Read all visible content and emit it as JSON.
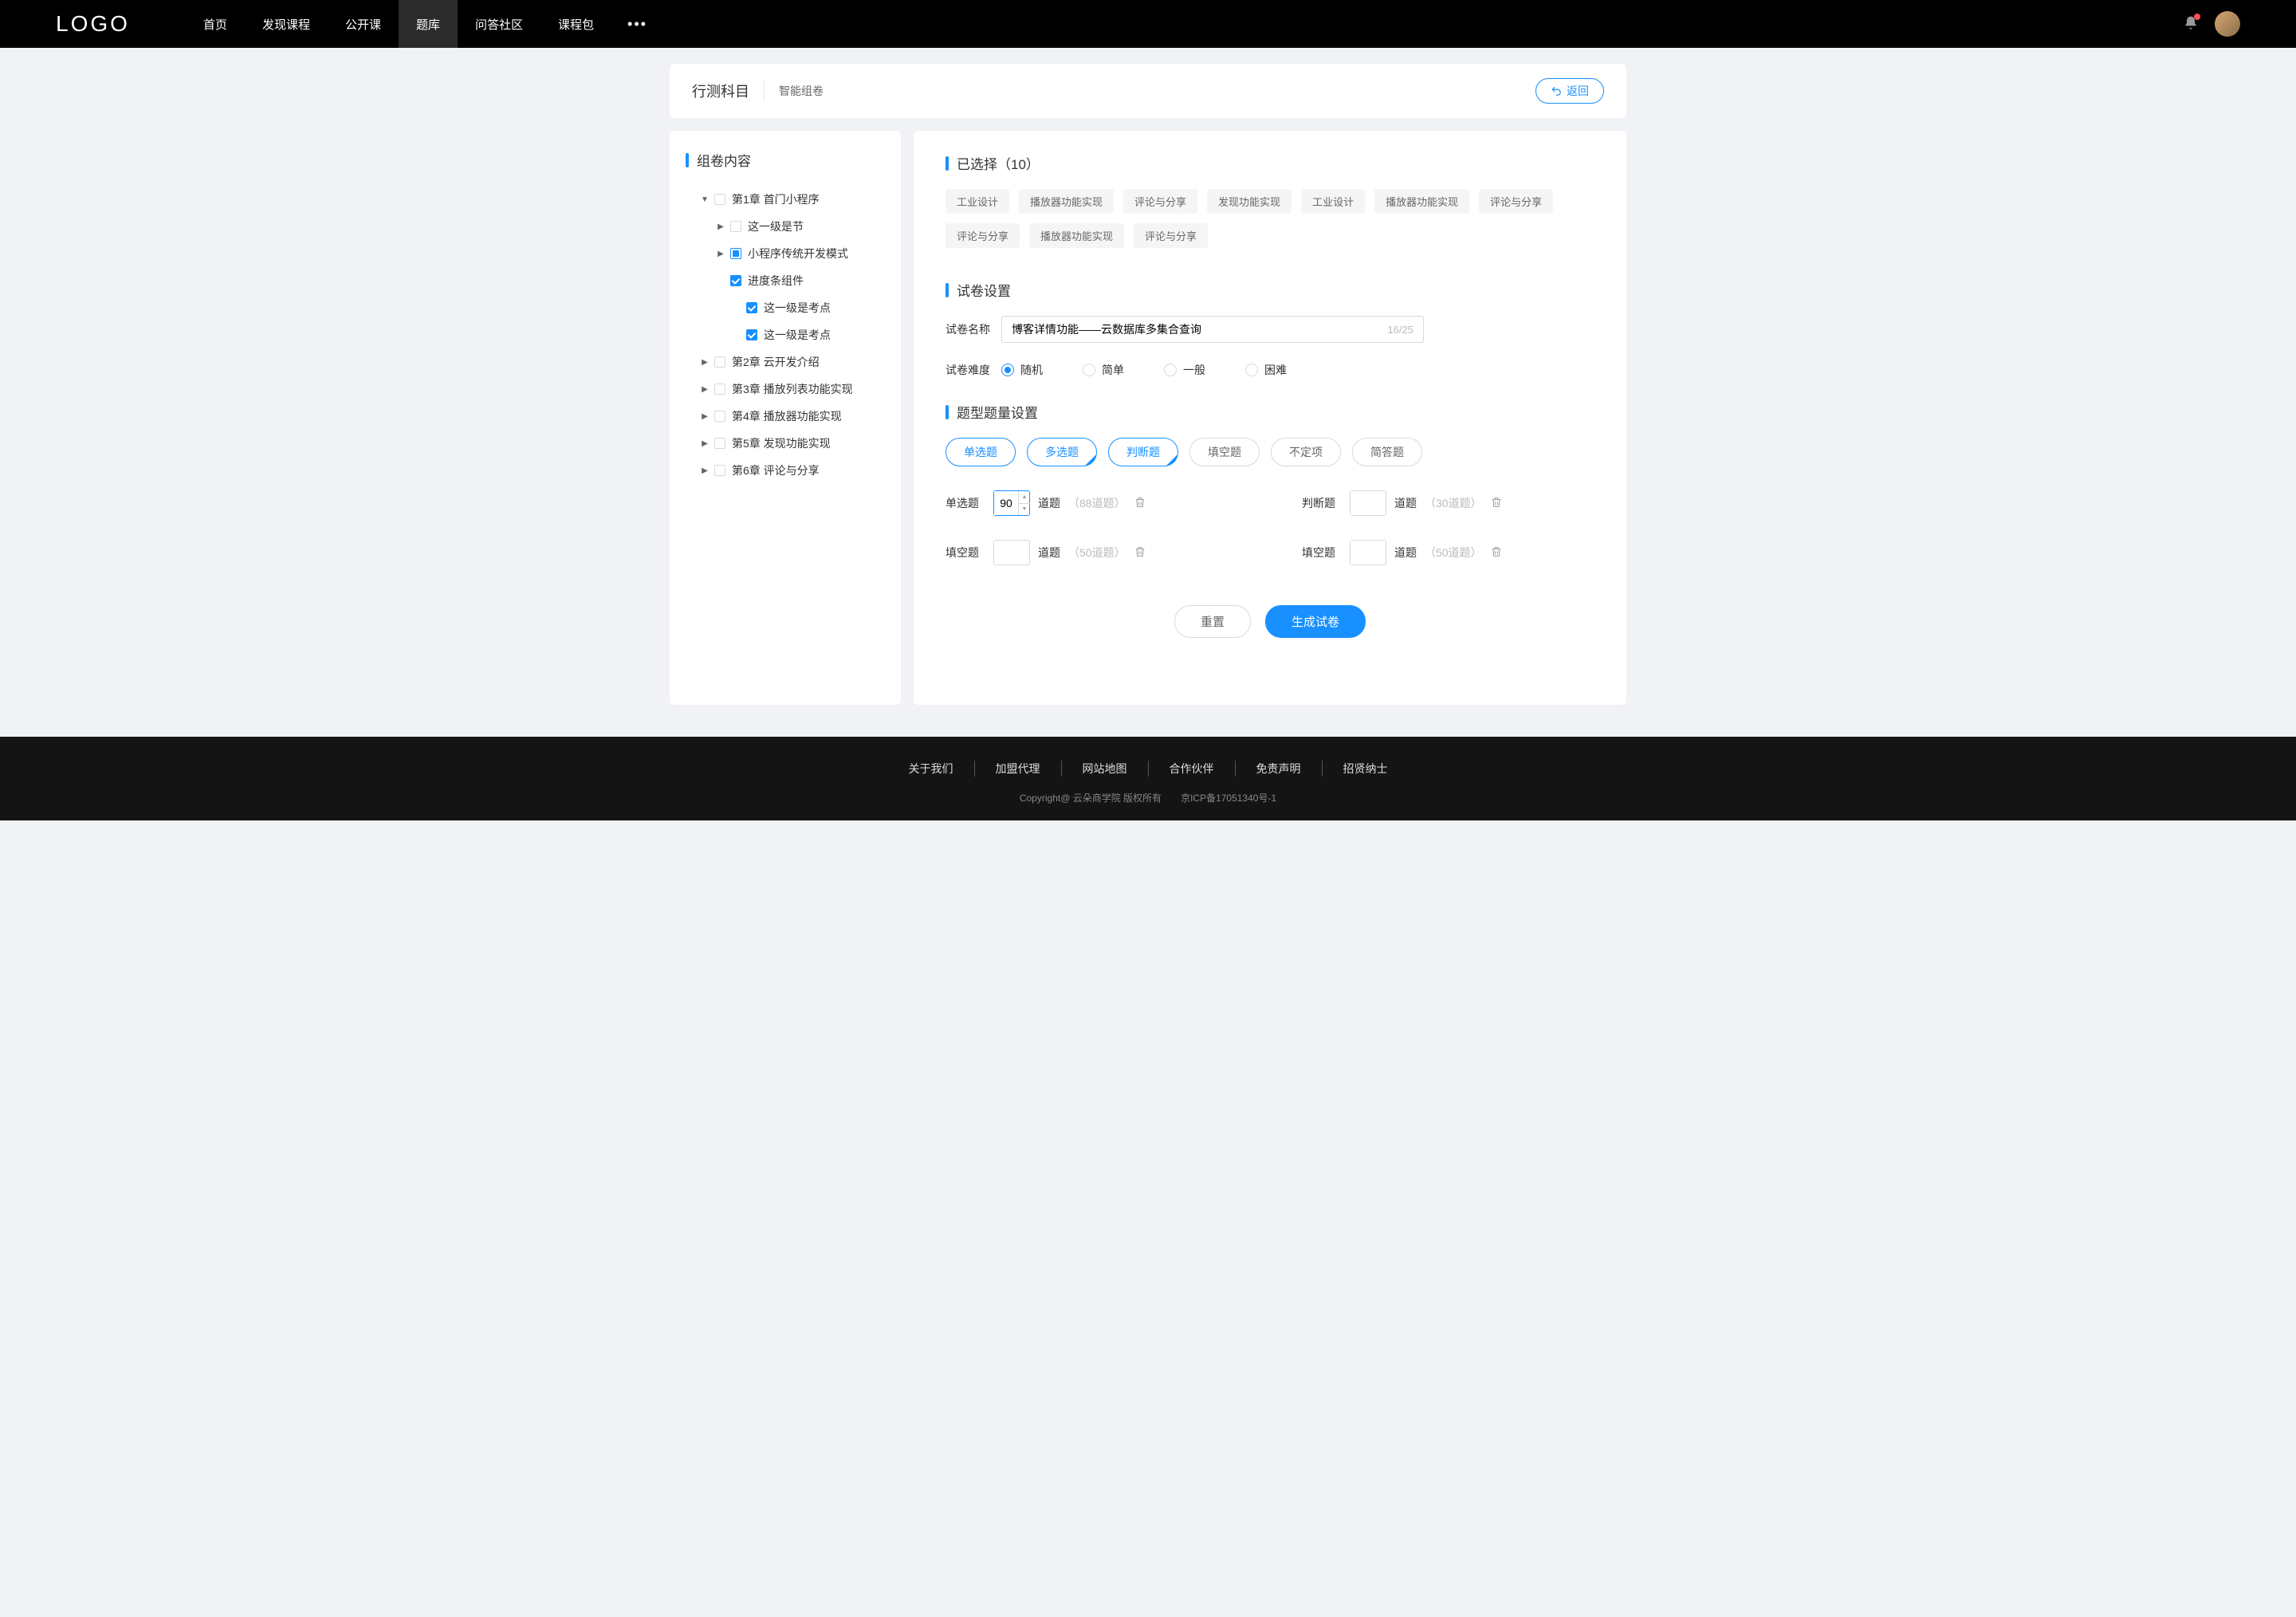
{
  "header": {
    "logo": "LOGO",
    "nav": [
      "首页",
      "发现课程",
      "公开课",
      "题库",
      "问答社区",
      "课程包"
    ],
    "active_index": 3
  },
  "page": {
    "title": "行测科目",
    "subtitle": "智能组卷",
    "back_label": "返回"
  },
  "sidebar": {
    "title": "组卷内容",
    "tree": [
      {
        "level": 0,
        "expand": "down",
        "check": "none",
        "label": "第1章 首门小程序"
      },
      {
        "level": 1,
        "expand": "right",
        "check": "none",
        "label": "这一级是节"
      },
      {
        "level": 1,
        "expand": "right",
        "check": "indeterminate",
        "label": "小程序传统开发模式"
      },
      {
        "level": 1,
        "expand": "",
        "check": "checked",
        "label": "进度条组件"
      },
      {
        "level": 2,
        "expand": "",
        "check": "checked",
        "label": "这一级是考点"
      },
      {
        "level": 2,
        "expand": "",
        "check": "checked",
        "label": "这一级是考点"
      },
      {
        "level": 0,
        "expand": "right",
        "check": "none",
        "label": "第2章 云开发介绍"
      },
      {
        "level": 0,
        "expand": "right",
        "check": "none",
        "label": "第3章 播放列表功能实现"
      },
      {
        "level": 0,
        "expand": "right",
        "check": "none",
        "label": "第4章 播放器功能实现"
      },
      {
        "level": 0,
        "expand": "right",
        "check": "none",
        "label": "第5章 发现功能实现"
      },
      {
        "level": 0,
        "expand": "right",
        "check": "none",
        "label": "第6章 评论与分享"
      }
    ]
  },
  "selected": {
    "title": "已选择（10）",
    "tags": [
      "工业设计",
      "播放器功能实现",
      "评论与分享",
      "发现功能实现",
      "工业设计",
      "播放器功能实现",
      "评论与分享",
      "评论与分享",
      "播放器功能实现",
      "评论与分享"
    ]
  },
  "settings": {
    "title": "试卷设置",
    "name_label": "试卷名称",
    "name_value": "博客详情功能——云数据库多集合查询",
    "name_counter": "16/25",
    "difficulty_label": "试卷难度",
    "difficulty_options": [
      "随机",
      "简单",
      "一般",
      "困难"
    ],
    "difficulty_selected": 0
  },
  "qtype": {
    "title": "题型题量设置",
    "types": [
      {
        "label": "单选题",
        "active": true,
        "corner": false
      },
      {
        "label": "多选题",
        "active": true,
        "corner": true
      },
      {
        "label": "判断题",
        "active": true,
        "corner": true
      },
      {
        "label": "填空题",
        "active": false,
        "corner": false
      },
      {
        "label": "不定项",
        "active": false,
        "corner": false
      },
      {
        "label": "简答题",
        "active": false,
        "corner": false
      }
    ],
    "rows": [
      {
        "label": "单选题",
        "value": "90",
        "unit": "道题",
        "limit": "（88道题）",
        "focus": true
      },
      {
        "label": "判断题",
        "value": "",
        "unit": "道题",
        "limit": "（30道题）",
        "focus": false
      },
      {
        "label": "填空题",
        "value": "",
        "unit": "道题",
        "limit": "（50道题）",
        "focus": false
      },
      {
        "label": "填空题",
        "value": "",
        "unit": "道题",
        "limit": "（50道题）",
        "focus": false
      }
    ]
  },
  "actions": {
    "reset": "重置",
    "generate": "生成试卷"
  },
  "footer": {
    "links": [
      "关于我们",
      "加盟代理",
      "网站地图",
      "合作伙伴",
      "免责声明",
      "招贤纳士"
    ],
    "copyright_left": "Copyright@  云朵商学院    版权所有",
    "copyright_right": "京ICP备17051340号-1"
  }
}
